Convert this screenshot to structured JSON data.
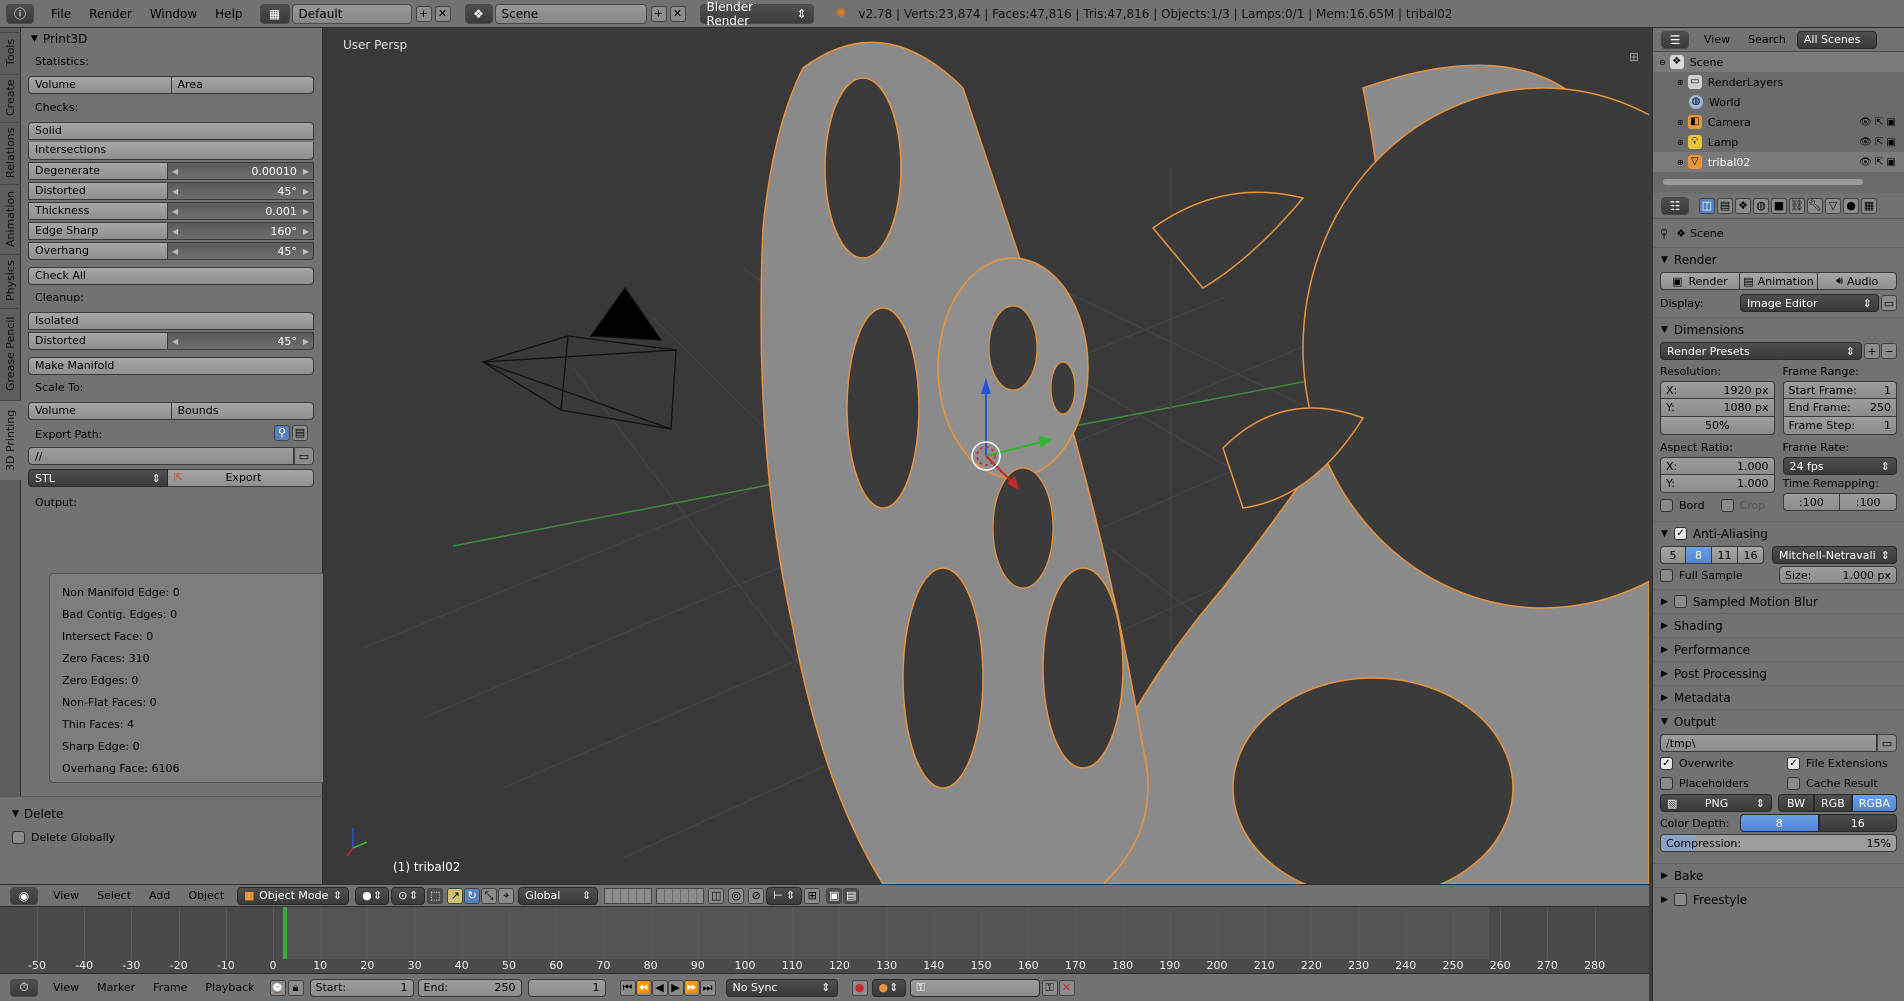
{
  "topbar": {
    "menus": [
      "File",
      "Render",
      "Window",
      "Help"
    ],
    "layout": "Default",
    "scene": "Scene",
    "engine": "Blender Render",
    "stats": "v2.78 | Verts:23,874 | Faces:47,816 | Tris:47,816 | Objects:1/3 | Lamps:0/1 | Mem:16.65M | tribal02"
  },
  "tabs": [
    "Tools",
    "Create",
    "Relations",
    "Animation",
    "Physics",
    "Grease Pencil",
    "3D Printing"
  ],
  "print3d": {
    "title": "Print3D",
    "statistics": "Statistics:",
    "volume": "Volume",
    "area": "Area",
    "checks": "Checks:",
    "solid": "Solid",
    "intersections": "Intersections",
    "degenerate_label": "Degenerate",
    "degenerate_value": "0.00010",
    "distorted_label": "Distorted",
    "distorted_value": "45°",
    "thickness_label": "Thickness",
    "thickness_value": "0.001",
    "edgesharp_label": "Edge Sharp",
    "edgesharp_value": "160°",
    "overhang_label": "Overhang",
    "overhang_value": "45°",
    "check_all": "Check All",
    "cleanup": "Cleanup:",
    "isolated": "Isolated",
    "distorted2_label": "Distorted",
    "distorted2_value": "45°",
    "make_manifold": "Make Manifold",
    "scale_to": "Scale To:",
    "scale_volume": "Volume",
    "scale_bounds": "Bounds",
    "export_path_label": "Export Path:",
    "export_path": "//",
    "format": "STL",
    "export": "Export",
    "output_label": "Output:",
    "output": [
      "Non Manifold Edge: 0",
      "Bad Contig. Edges: 0",
      "Intersect Face: 0",
      "Zero Faces: 310",
      "Zero Edges: 0",
      "Non-Flat Faces: 0",
      "Thin Faces: 4",
      "Sharp Edge: 0",
      "Overhang Face: 6106"
    ]
  },
  "delete_panel": {
    "title": "Delete",
    "globally": "Delete Globally"
  },
  "viewport": {
    "label": "User Persp",
    "object": "(1) tribal02"
  },
  "vpheader": {
    "menus": [
      "View",
      "Select",
      "Add",
      "Object"
    ],
    "mode": "Object Mode",
    "orientation": "Global"
  },
  "timeline": {
    "ticks": [
      "-50",
      "-40",
      "-30",
      "-20",
      "-10",
      "0",
      "10",
      "20",
      "30",
      "40",
      "50",
      "60",
      "70",
      "80",
      "90",
      "100",
      "110",
      "120",
      "130",
      "140",
      "150",
      "160",
      "170",
      "180",
      "190",
      "200",
      "210",
      "220",
      "230",
      "240",
      "250",
      "260",
      "270",
      "280"
    ],
    "menus": [
      "View",
      "Marker",
      "Frame",
      "Playback"
    ],
    "start_label": "Start:",
    "start": "1",
    "end_label": "End:",
    "end": "250",
    "current": "1",
    "sync": "No Sync"
  },
  "outliner": {
    "menus": [
      "View",
      "Search"
    ],
    "filter": "All Scenes",
    "items": [
      "Scene",
      "RenderLayers",
      "World",
      "Camera",
      "Lamp",
      "tribal02"
    ]
  },
  "properties": {
    "scene": "Scene",
    "render_section": "Render",
    "render_btn": "Render",
    "animation_btn": "Animation",
    "audio_btn": "Audio",
    "display_label": "Display:",
    "display_value": "Image Editor",
    "dimensions": "Dimensions",
    "render_presets": "Render Presets",
    "resolution": "Resolution:",
    "res_x_label": "X:",
    "res_x": "1920 px",
    "res_y_label": "Y:",
    "res_y": "1080 px",
    "res_pct": "50%",
    "frame_range": "Frame Range:",
    "start_frame_label": "Start Frame:",
    "start_frame": "1",
    "end_frame_label": "End Frame:",
    "end_frame": "250",
    "frame_step_label": "Frame Step:",
    "frame_step": "1",
    "aspect_ratio": "Aspect Ratio:",
    "asp_x_label": "X:",
    "asp_x": "1.000",
    "asp_y_label": "Y:",
    "asp_y": "1.000",
    "frame_rate": "Frame Rate:",
    "fps": "24 fps",
    "time_remapping": "Time Remapping:",
    "remap_old": ":100",
    "remap_new": ":100",
    "bord": "Bord",
    "crop": "Crop",
    "anti_aliasing": "Anti-Aliasing",
    "aa_samples": [
      "5",
      "8",
      "11",
      "16"
    ],
    "aa_filter": "Mitchell-Netravali",
    "full_sample": "Full Sample",
    "size_label": "Size:",
    "size": "1.000 px",
    "sections": [
      "Sampled Motion Blur",
      "Shading",
      "Performance",
      "Post Processing",
      "Metadata"
    ],
    "output": "Output",
    "output_path": "/tmp\\",
    "overwrite": "Overwrite",
    "file_extensions": "File Extensions",
    "placeholders": "Placeholders",
    "cache_result": "Cache Result",
    "format": "PNG",
    "bw": "BW",
    "rgb": "RGB",
    "rgba": "RGBA",
    "color_depth_label": "Color Depth:",
    "depth8": "8",
    "depth16": "16",
    "compression_label": "Compression:",
    "compression": "15%",
    "bake": "Bake",
    "freestyle": "Freestyle"
  },
  "colors": {
    "selection": "#e8943a",
    "x_axis": "#c82828",
    "y_axis": "#2eb82e",
    "z_axis": "#2a4fd8",
    "accent": "#5680c2"
  }
}
